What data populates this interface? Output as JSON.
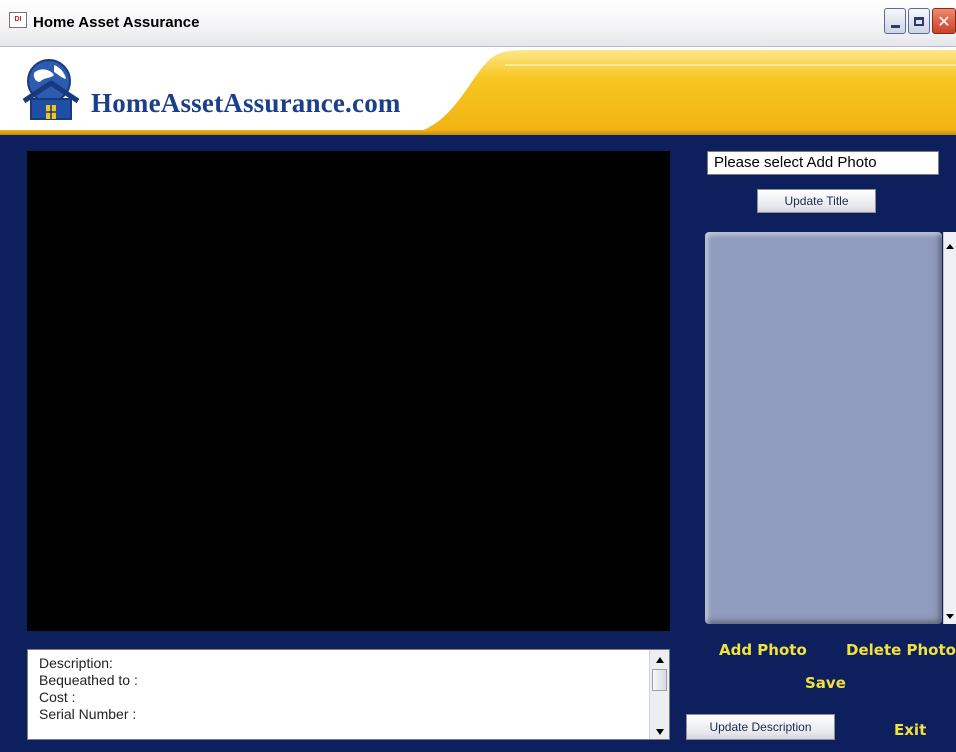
{
  "window": {
    "app_icon": "app-icon",
    "title": "Home Asset Assurance",
    "buttons": [
      "minimize-icon",
      "maximize-icon",
      "close-icon"
    ]
  },
  "banner": {
    "logo_icon": "house-globe-logo-icon",
    "brand": "HomeAssetAssurance.com",
    "accent_color": "#f7c21a",
    "text_color": "#1c3f8c"
  },
  "photo_panel": {
    "title_field_value": "Please select Add Photo",
    "update_title_label": "Update Title"
  },
  "actions": {
    "add_photo": "Add Photo",
    "delete_photo": "Delete Photo",
    "save": "Save",
    "update_description": "Update Description",
    "exit": "Exit",
    "link_color": "#f2e23c"
  },
  "description": {
    "lines": [
      "Description:",
      "Bequeathed to :",
      "Cost :",
      "Serial Number :"
    ]
  },
  "colors": {
    "background": "#0d1f5c",
    "viewer": "#000000",
    "photo_list": "#8f9cbd"
  }
}
